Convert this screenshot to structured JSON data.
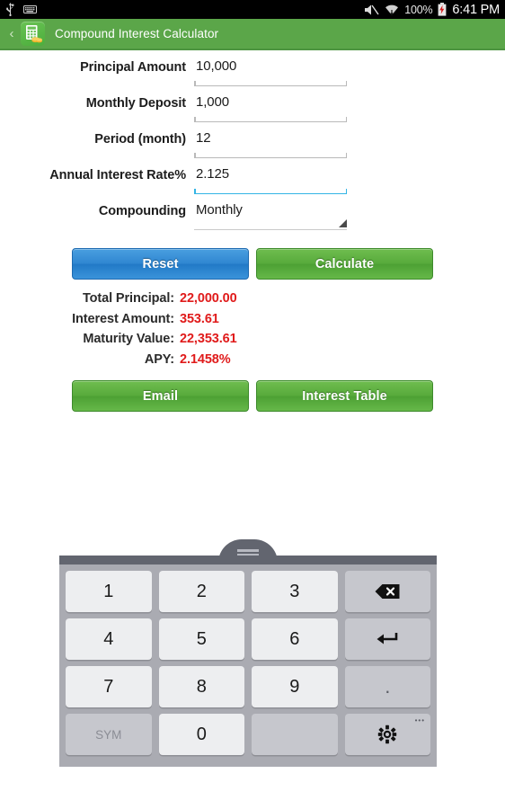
{
  "statusbar": {
    "left_icons": [
      "usb-icon",
      "keyboard-icon"
    ],
    "mute_icon": "mute-icon",
    "wifi_icon": "wifi-icon",
    "battery_percent": "100%",
    "battery_icon": "battery-charging-icon",
    "time": "6:41 PM"
  },
  "appbar": {
    "back_label": "‹",
    "app_icon": "calculator-coins-icon",
    "title": "Compound Interest Calculator"
  },
  "form": {
    "fields": [
      {
        "label": "Principal Amount",
        "value": "10,000",
        "focused": false
      },
      {
        "label": "Monthly Deposit",
        "value": "1,000",
        "focused": false
      },
      {
        "label": "Period (month)",
        "value": "12",
        "focused": false
      },
      {
        "label": "Annual Interest Rate%",
        "value": "2.125",
        "focused": true
      }
    ],
    "compounding": {
      "label": "Compounding",
      "value": "Monthly",
      "options": [
        "Monthly"
      ]
    }
  },
  "actions": {
    "reset_label": "Reset",
    "calculate_label": "Calculate",
    "email_label": "Email",
    "interest_table_label": "Interest Table"
  },
  "results": [
    {
      "label": "Total Principal:",
      "value": "22,000.00"
    },
    {
      "label": "Interest Amount:",
      "value": "353.61"
    },
    {
      "label": "Maturity Value:",
      "value": "22,353.61"
    },
    {
      "label": "APY:",
      "value": "2.1458%"
    }
  ],
  "keyboard": {
    "handle": "drag-handle",
    "rows": [
      [
        {
          "t": "1",
          "s": "light"
        },
        {
          "t": "2",
          "s": "light"
        },
        {
          "t": "3",
          "s": "light"
        },
        {
          "t": "",
          "s": "backspace",
          "icon": "backspace-icon"
        }
      ],
      [
        {
          "t": "4",
          "s": "light"
        },
        {
          "t": "5",
          "s": "light"
        },
        {
          "t": "6",
          "s": "light"
        },
        {
          "t": "",
          "s": "enter",
          "icon": "enter-icon"
        }
      ],
      [
        {
          "t": "7",
          "s": "light"
        },
        {
          "t": "8",
          "s": "light"
        },
        {
          "t": "9",
          "s": "light"
        },
        {
          "t": ".",
          "s": "dot"
        }
      ],
      [
        {
          "t": "SYM",
          "s": "sym"
        },
        {
          "t": "0",
          "s": "light"
        },
        {
          "t": "",
          "s": "blank"
        },
        {
          "t": "",
          "s": "settings",
          "icon": "gear-icon",
          "dots": "•••"
        }
      ]
    ]
  },
  "colors": {
    "appbar_green": "#5ba649",
    "button_green": "#57aa3b",
    "button_blue": "#2f86d0",
    "result_red": "#e01b1b",
    "focus_blue": "#33b5e5",
    "keyboard_bg": "#aaabb2"
  }
}
